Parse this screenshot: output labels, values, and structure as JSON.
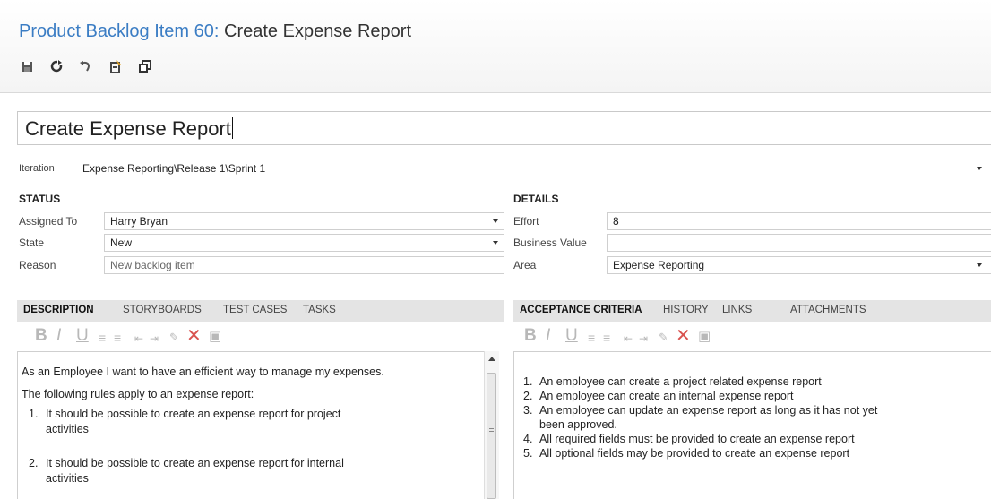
{
  "header": {
    "item_type": "Product Backlog Item 60:",
    "item_name": "Create Expense Report",
    "toolbar": [
      {
        "icon": "save-icon"
      },
      {
        "icon": "refresh-icon"
      },
      {
        "icon": "undo-icon"
      },
      {
        "icon": "paste-icon"
      },
      {
        "icon": "copy-icon"
      }
    ]
  },
  "title_field": {
    "value": "Create Expense Report"
  },
  "iteration": {
    "label": "Iteration",
    "value": "Expense Reporting\\Release 1\\Sprint 1"
  },
  "status": {
    "heading": "STATUS",
    "assigned_to": {
      "label": "Assigned To",
      "value": "Harry Bryan"
    },
    "state": {
      "label": "State",
      "value": "New"
    },
    "reason": {
      "label": "Reason",
      "value": "New backlog item"
    }
  },
  "details": {
    "heading": "DETAILS",
    "effort": {
      "label": "Effort",
      "value": "8"
    },
    "business_value": {
      "label": "Business Value",
      "value": ""
    },
    "area": {
      "label": "Area",
      "value": "Expense Reporting"
    }
  },
  "left_tabs": [
    "DESCRIPTION",
    "STORYBOARDS",
    "TEST CASES",
    "TASKS"
  ],
  "right_tabs": [
    "ACCEPTANCE CRITERIA",
    "HISTORY",
    "LINKS",
    "ATTACHMENTS"
  ],
  "rte_icons": [
    "bold-icon",
    "italic-icon",
    "underline-icon",
    "bullet-list-icon",
    "numbered-list-icon",
    "decrease-indent-icon",
    "increase-indent-icon",
    "highlight-icon",
    "clear-format-icon",
    "insert-image-icon"
  ],
  "rte_glyphs": [
    "B",
    "I",
    "U"
  ],
  "description": {
    "line1": "As an Employee I want to have an efficient way to manage my expenses.",
    "line2": "The following rules apply to an expense report:",
    "rules": [
      {
        "num": "1.",
        "line_a": "It should be possible to create an expense report for project",
        "line_b": "activities"
      },
      {
        "num": "2.",
        "line_a": "It should be possible to create an expense report for internal",
        "line_b": "activities"
      }
    ]
  },
  "acceptance_criteria": [
    {
      "num": "1.",
      "line_a": "An employee can create a project related expense report",
      "line_b": ""
    },
    {
      "num": "2.",
      "line_a": "An employee can create an internal expense report",
      "line_b": ""
    },
    {
      "num": "3.",
      "line_a": "An employee can update an expense report as long as it has not yet",
      "line_b": "been approved."
    },
    {
      "num": "4.",
      "line_a": "All required fields must be provided to create an expense report",
      "line_b": ""
    },
    {
      "num": "5.",
      "line_a": "All optional fields may be provided to create an expense report",
      "line_b": ""
    }
  ],
  "colors": {
    "title_link": "#3b7dc4",
    "tab_bar": "#e4e4e4",
    "delete_red": "#d9534f"
  }
}
